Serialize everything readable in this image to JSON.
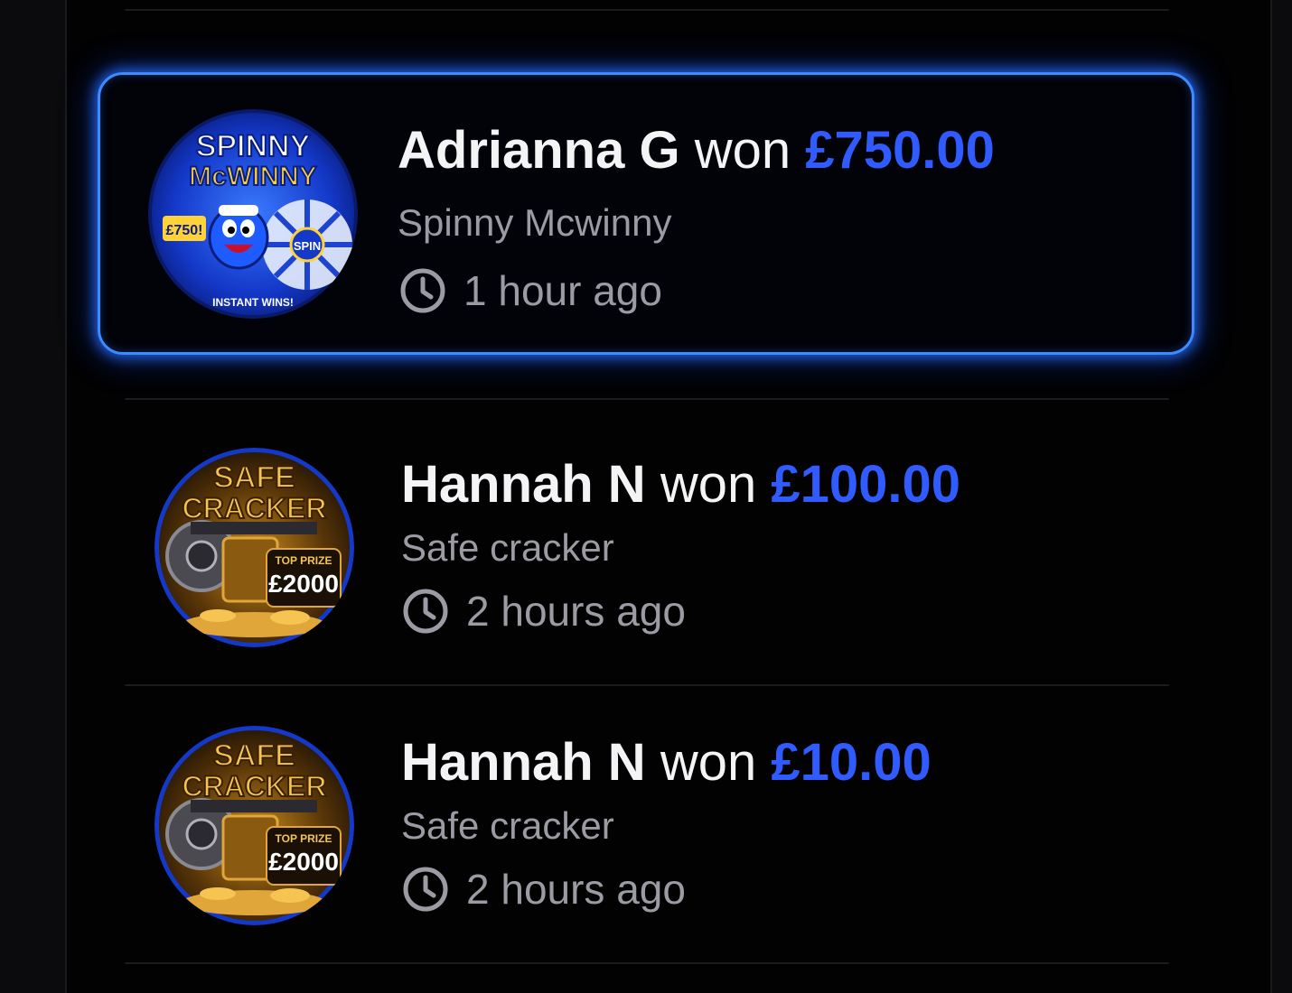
{
  "wins": [
    {
      "winner": "Adrianna G",
      "won_label": "won",
      "amount": "£750.00",
      "game": "Spinny Mcwinny",
      "time": "1 hour ago",
      "highlighted": true,
      "thumbnail": {
        "icon": "spinny-mcwinny-game-art",
        "text_line1": "SPINNY",
        "text_line2": "McWINNY",
        "badge": "£750!",
        "spin_label": "SPIN",
        "footer": "INSTANT WINS!"
      }
    },
    {
      "winner": "Hannah N",
      "won_label": "won",
      "amount": "£100.00",
      "game": "Safe cracker",
      "time": "2 hours ago",
      "highlighted": false,
      "thumbnail": {
        "icon": "safe-cracker-game-art",
        "text_line1": "SAFE",
        "text_line2": "CRACKER",
        "top_prize_label": "TOP PRIZE",
        "top_prize": "£2000"
      }
    },
    {
      "winner": "Hannah N",
      "won_label": "won",
      "amount": "£10.00",
      "game": "Safe cracker",
      "time": "2 hours ago",
      "highlighted": false,
      "thumbnail": {
        "icon": "safe-cracker-game-art",
        "text_line1": "SAFE",
        "text_line2": "CRACKER",
        "top_prize_label": "TOP PRIZE",
        "top_prize": "£2000"
      }
    }
  ],
  "colors": {
    "amount": "#2f5bff",
    "highlight_border": "#3d8bff",
    "name": "#f4f4f6",
    "meta": "#9b9ba3"
  }
}
